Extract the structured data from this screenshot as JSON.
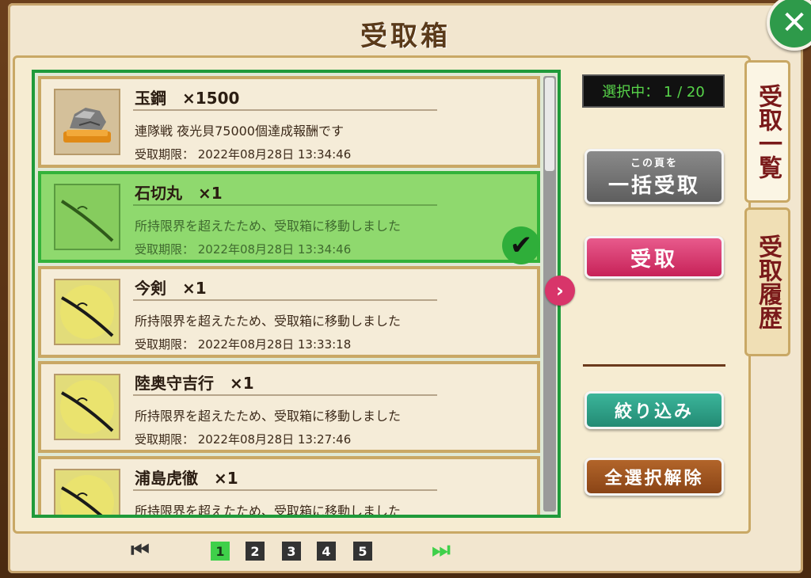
{
  "header": {
    "title": "受取箱"
  },
  "counter": {
    "text": "選択中： 1 / 20"
  },
  "items": [
    {
      "name": "玉鋼　×1500",
      "desc": "連隊戦 夜光貝75000個達成報酬です",
      "date": "受取期限： 2022年08月28日 13:34:46",
      "icon": "steel-ore-icon",
      "selected": false
    },
    {
      "name": "石切丸　×1",
      "desc": "所持限界を超えたため、受取箱に移動しました",
      "date": "受取期限： 2022年08月28日 13:34:46",
      "icon": "sword-icon",
      "selected": true
    },
    {
      "name": "今剣　×1",
      "desc": "所持限界を超えたため、受取箱に移動しました",
      "date": "受取期限： 2022年08月28日 13:33:18",
      "icon": "sword-icon",
      "selected": false
    },
    {
      "name": "陸奥守吉行　×1",
      "desc": "所持限界を超えたため、受取箱に移動しました",
      "date": "受取期限： 2022年08月28日 13:27:46",
      "icon": "sword-icon",
      "selected": false
    },
    {
      "name": "浦島虎徹　×1",
      "desc": "所持限界を超えたため、受取箱に移動しました",
      "date": "",
      "icon": "sword-icon",
      "selected": false
    }
  ],
  "buttons": {
    "bulk_small": "この頁を",
    "bulk_big": "一括受取",
    "receive": "受取",
    "filter": "絞り込み",
    "clear_selection": "全選択解除"
  },
  "tabs": {
    "list": "受取一覧",
    "history": "受取履歴"
  },
  "pagination": {
    "pages": [
      "1",
      "2",
      "3",
      "4",
      "5"
    ],
    "current": "1"
  },
  "icons": {
    "close": "close-icon",
    "next_arrow": "chevron-right-icon",
    "check": "checkmark-icon",
    "first_page": "first-page-icon",
    "last_page": "last-page-icon"
  },
  "colors": {
    "selected_green": "#8fd96e",
    "list_border": "#1f9a3a",
    "receive_pink": "#d8356a",
    "filter_teal": "#2e9a82",
    "clear_brown": "#9a5220"
  }
}
